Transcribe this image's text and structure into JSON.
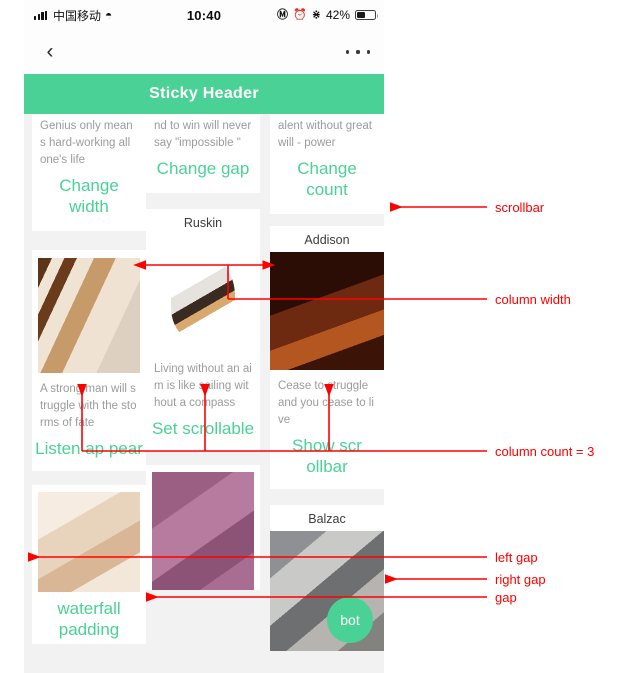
{
  "status_bar": {
    "signal_icon": "signal-bars-icon",
    "carrier": "中国移动",
    "wifi_icon": "wifi-icon",
    "time": "10:40",
    "location_icon": "location-arrow-icon",
    "alarm_icon": "alarm-clock-icon",
    "bluetooth_icon": "bluetooth-icon",
    "battery_percent": "42%",
    "battery_icon": "battery-icon"
  },
  "nav_bar": {
    "back_icon": "chevron-left-icon",
    "more_icon": "more-horizontal-icon"
  },
  "sticky_header": {
    "title": "Sticky Header"
  },
  "floating_button": {
    "label": "bot"
  },
  "columns": [
    {
      "name": "column-1",
      "cards": [
        {
          "type": "quote",
          "quote": "Genius only means hard-working all one's life",
          "label": "Change width"
        },
        {
          "type": "photo",
          "photo": "cat-photo-pale-tabby",
          "quote": "A strong man will struggle with the storms of fate",
          "label": "Listen ap pear"
        },
        {
          "type": "photo",
          "photo": "cat-photo-cream-kitten",
          "label": "waterfall padding"
        }
      ]
    },
    {
      "name": "column-2",
      "cards": [
        {
          "type": "quote",
          "quote": "nd to win will never say \"impossible \"",
          "label": "Change gap"
        },
        {
          "type": "photo",
          "author": "Ruskin",
          "photo": "cat-photo-calico",
          "quote": "Living without an aim is like sailing without a compass",
          "label": "Set scrollable"
        },
        {
          "type": "photo",
          "photo": "cat-photo-grey-kitten-purple"
        }
      ]
    },
    {
      "name": "column-3",
      "cards": [
        {
          "type": "quote",
          "quote": "alent without great will - power",
          "label": "Change count"
        },
        {
          "type": "photo",
          "author": "Addison",
          "photo": "cat-photo-dark-red",
          "quote": "Cease to struggle and you cease to live",
          "label": "Show scr ollbar"
        },
        {
          "type": "photo",
          "author": "Balzac",
          "photo": "cat-photo-grey-stone"
        }
      ]
    }
  ],
  "annotations": [
    {
      "name": "scrollbar",
      "text": "scrollbar"
    },
    {
      "name": "column-width",
      "text": "column width"
    },
    {
      "name": "column-count",
      "text": "column count = 3"
    },
    {
      "name": "left-gap",
      "text": "left gap"
    },
    {
      "name": "right-gap",
      "text": "right gap"
    },
    {
      "name": "gap",
      "text": "gap"
    }
  ],
  "colors": {
    "accent_green": "#4ad296",
    "annotation_red": "#ff0000",
    "page_background": "#f2f2f2",
    "card_background": "#ffffff",
    "quote_text": "#9b9b9b"
  }
}
